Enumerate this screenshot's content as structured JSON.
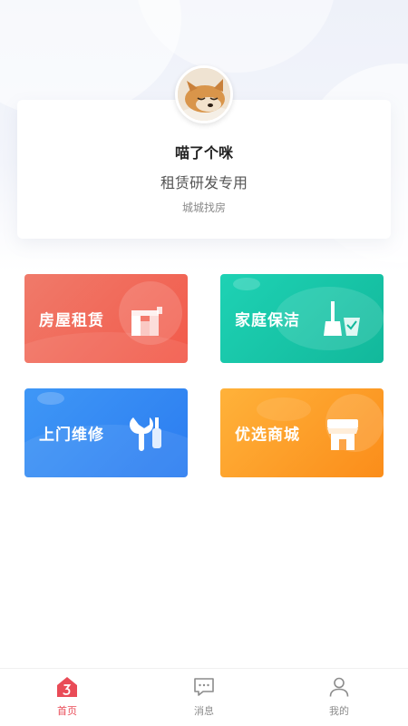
{
  "profile": {
    "name": "喵了个咪",
    "subtitle": "租赁研发专用",
    "caption": "城城找房"
  },
  "services": [
    {
      "label": "房屋租赁",
      "icon": "house-icon",
      "color": "#f25a4a"
    },
    {
      "label": "家庭保洁",
      "icon": "broom-bucket-icon",
      "color": "#12b89b"
    },
    {
      "label": "上门维修",
      "icon": "wrench-screwdriver-icon",
      "color": "#2b7cf0"
    },
    {
      "label": "优选商城",
      "icon": "storefront-icon",
      "color": "#fb8d1a"
    }
  ],
  "tabbar": {
    "items": [
      {
        "label": "首页",
        "icon": "home-icon",
        "active": true
      },
      {
        "label": "消息",
        "icon": "message-icon",
        "active": false
      },
      {
        "label": "我的",
        "icon": "user-icon",
        "active": false
      }
    ],
    "active_color": "#e94b57",
    "inactive_color": "#8c8c8c"
  }
}
